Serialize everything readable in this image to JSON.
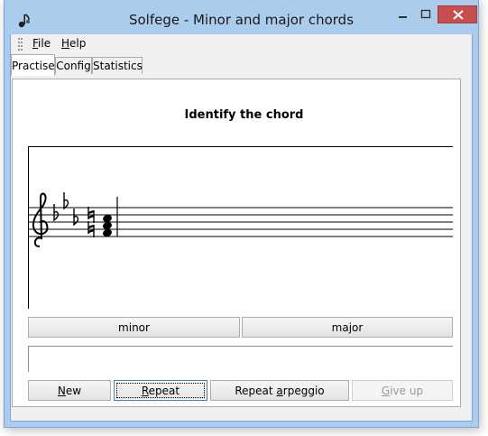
{
  "window": {
    "title": "Solfege - Minor and major chords",
    "accent_color": "#acccee",
    "close_color": "#c74f50"
  },
  "menu": {
    "items": [
      {
        "label_accel": "F",
        "label_rest": "ile"
      },
      {
        "label_accel": "H",
        "label_rest": "elp"
      }
    ]
  },
  "tabs": [
    {
      "label": "Practise",
      "active": true
    },
    {
      "label": "Config",
      "active": false
    },
    {
      "label": "Statistics",
      "active": false
    }
  ],
  "practise": {
    "heading": "Identify the chord",
    "answers": [
      {
        "label": "minor"
      },
      {
        "label": "major"
      }
    ],
    "feedback_text": "",
    "actions": {
      "new_accel": "N",
      "new_rest": "ew",
      "repeat_accel": "R",
      "repeat_rest": "epeat",
      "repeat_arpeggio_prefix": "Repeat ",
      "repeat_arpeggio_accel": "a",
      "repeat_arpeggio_rest": "rpeggio",
      "giveup_accel": "G",
      "giveup_rest": "ive up"
    }
  },
  "icons": {
    "app": "music-note-icon",
    "clef": "treble-clef-icon",
    "flat": "flat-sign-icon",
    "natural": "natural-sign-icon"
  }
}
